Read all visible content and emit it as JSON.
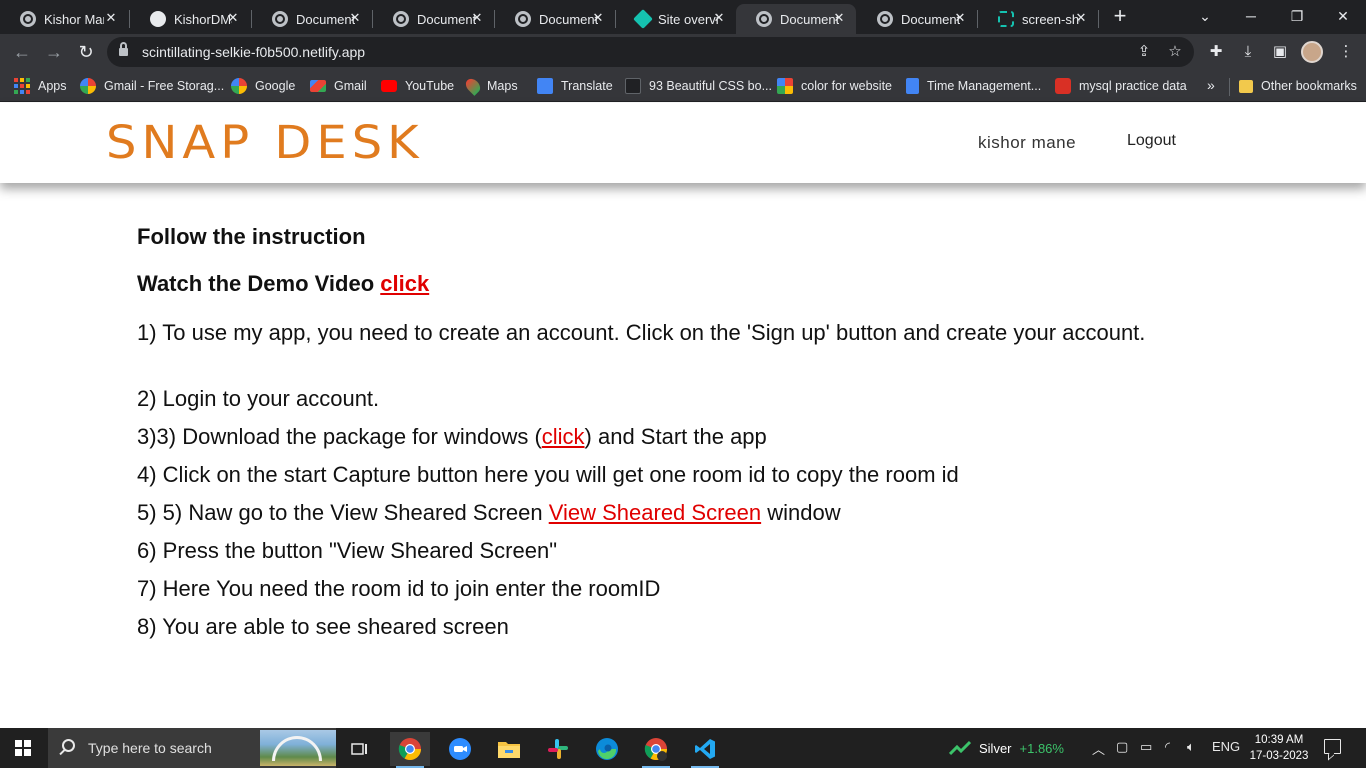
{
  "browser": {
    "tabs": [
      {
        "title": "Kishor Man",
        "icon": "globe-icon"
      },
      {
        "title": "KishorDMa",
        "icon": "github-icon"
      },
      {
        "title": "Document",
        "icon": "globe-icon"
      },
      {
        "title": "Document",
        "icon": "globe-icon"
      },
      {
        "title": "Document",
        "icon": "globe-icon"
      },
      {
        "title": "Site overvi",
        "icon": "netlify-icon"
      },
      {
        "title": "Document",
        "icon": "globe-icon",
        "active": true
      },
      {
        "title": "Document",
        "icon": "globe-icon"
      },
      {
        "title": "screen-she",
        "icon": "dashed-square-icon"
      }
    ],
    "new_tab_label": "+",
    "url": "scintillating-selkie-f0b500.netlify.app",
    "bookmarks": [
      {
        "label": "Apps",
        "icon": "apps-grid-icon"
      },
      {
        "label": "Gmail - Free Storag...",
        "icon": "google-icon"
      },
      {
        "label": "Google",
        "icon": "google-icon"
      },
      {
        "label": "Gmail",
        "icon": "gmail-icon"
      },
      {
        "label": "YouTube",
        "icon": "youtube-icon"
      },
      {
        "label": "Maps",
        "icon": "maps-pin-icon"
      },
      {
        "label": "Translate",
        "icon": "translate-icon"
      },
      {
        "label": "93 Beautiful CSS bo...",
        "icon": "css-icon"
      },
      {
        "label": "color for website",
        "icon": "color-palette-icon"
      },
      {
        "label": "Time Management...",
        "icon": "docs-icon"
      },
      {
        "label": "mysql practice data",
        "icon": "mysql-icon"
      }
    ],
    "bookmarks_overflow": "»",
    "other_bookmarks": "Other bookmarks"
  },
  "site": {
    "logo": "SNAP DESK",
    "user_name": "kishor mane",
    "logout_label": "Logout",
    "heading_follow": "Follow the instruction",
    "heading_watch": "Watch the Demo Video ",
    "watch_link": "click",
    "steps": {
      "s1": "1) To use my app, you need to create an account. Click on the 'Sign up' button and create your account.",
      "s2": "2) Login to your account.",
      "s3_pre": "3)3) Download the package for windows (",
      "s3_link": "click",
      "s3_post": ") and Start the app",
      "s4": "4) Click on the start Capture button here you will get one room id to copy the room id",
      "s5_pre": "5) 5) Naw go to the View Sheared Screen ",
      "s5_link": "View Sheared Screen",
      "s5_post": " window",
      "s6": "6) Press the button \"View Sheared Screen\"",
      "s7": "7) Here You need the room id to join enter the roomID",
      "s8": "8) You are able to see sheared screen"
    }
  },
  "taskbar": {
    "search_placeholder": "Type here to search",
    "stock_name": "Silver",
    "stock_change": "+1.86%",
    "language": "ENG",
    "time": "10:39 AM",
    "date": "17-03-2023"
  },
  "colors": {
    "logo_orange": "#e07b1f",
    "link_red": "#e00000",
    "chrome_dark": "#202124",
    "chrome_toolbar": "#35363a"
  }
}
